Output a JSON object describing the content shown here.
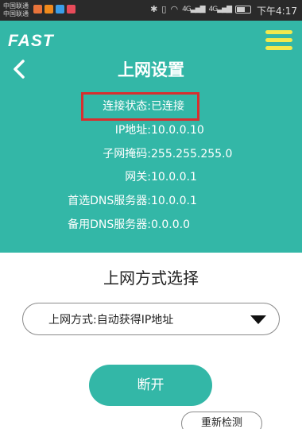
{
  "status_bar": {
    "carrier_1": "中国联通",
    "carrier_2": "中国联通",
    "notification_icons": [
      "weibo-icon",
      "taobao-icon",
      "telegram-icon",
      "app-icon"
    ],
    "system_icons": [
      "bluetooth-icon",
      "vibrate-icon",
      "wifi-icon",
      "signal-icon",
      "signal-icon",
      "battery-icon"
    ],
    "signal_label_1": "4G",
    "signal_label_2": "4G",
    "clock": "下午4:17"
  },
  "header": {
    "logo": "FAST",
    "title": "上网设置",
    "menu_icon": "hamburger-icon",
    "back_icon": "back-arrow-icon"
  },
  "connection_info": [
    {
      "label": "连接状态:",
      "value": "已连接"
    },
    {
      "label": "IP地址:",
      "value": "10.0.0.10"
    },
    {
      "label": "子网掩码:",
      "value": "255.255.255.0"
    },
    {
      "label": "网关:",
      "value": "10.0.0.1"
    },
    {
      "label": "首选DNS服务器:",
      "value": "10.0.0.1"
    },
    {
      "label": "备用DNS服务器:",
      "value": "0.0.0.0"
    }
  ],
  "wan_section": {
    "title": "上网方式选择",
    "mode_select": "上网方式:自动获得IP地址",
    "disconnect_label": "断开",
    "redetect_label": "重新检测"
  },
  "colors": {
    "teal": "#33b7a7",
    "menu_yellow": "#f2e94e",
    "highlight_red": "#d72f2f",
    "status_bar": "#2a2a2a"
  }
}
